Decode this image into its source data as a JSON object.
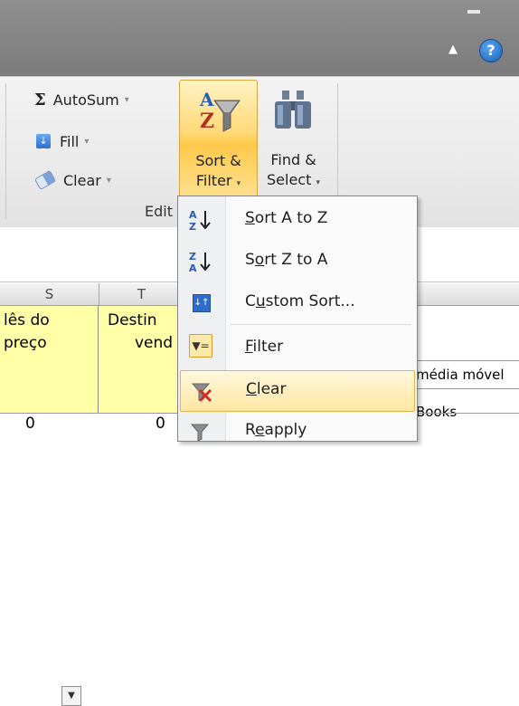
{
  "ribbon": {
    "autosum_icon": "Σ",
    "autosum_label": "AutoSum",
    "fill_label": "Fill",
    "clear_label": "Clear",
    "sort_filter_label_1": "Sort &",
    "sort_filter_label_2": "Filter",
    "find_select_label_1": "Find &",
    "find_select_label_2": "Select",
    "group_label": "Edit",
    "help": "?"
  },
  "sheet": {
    "columns": [
      "S",
      "T"
    ],
    "cell_s_lines": [
      "lês do",
      "preço"
    ],
    "cell_t_lines": [
      "Destin",
      "vend"
    ],
    "cell_media_movel": "média móvel",
    "cell_books": "Books",
    "bottom_values": [
      "0",
      "0"
    ]
  },
  "menu": {
    "items": [
      {
        "icon": "sort-az-icon",
        "pre": "",
        "accel": "S",
        "post": "ort A to Z"
      },
      {
        "icon": "sort-za-icon",
        "pre": "S",
        "accel": "o",
        "post": "rt Z to A"
      },
      {
        "icon": "custom-sort-icon",
        "pre": "C",
        "accel": "u",
        "post": "stom Sort..."
      },
      {
        "icon": "filter-icon",
        "pre": "",
        "accel": "F",
        "post": "ilter"
      },
      {
        "icon": "clear-filter-icon",
        "pre": "",
        "accel": "C",
        "post": "lear"
      },
      {
        "icon": "reapply-icon",
        "pre": "R",
        "accel": "e",
        "post": "apply"
      }
    ],
    "highlighted_item": "Clear"
  },
  "colors": {
    "title_bar": "#7b7b7b",
    "ribbon_bg": "#eaeaea",
    "sort_filter_highlight": "#ffc94a",
    "yellow_cell": "#ffffa8",
    "menu_hover": "#ffe7a3"
  }
}
